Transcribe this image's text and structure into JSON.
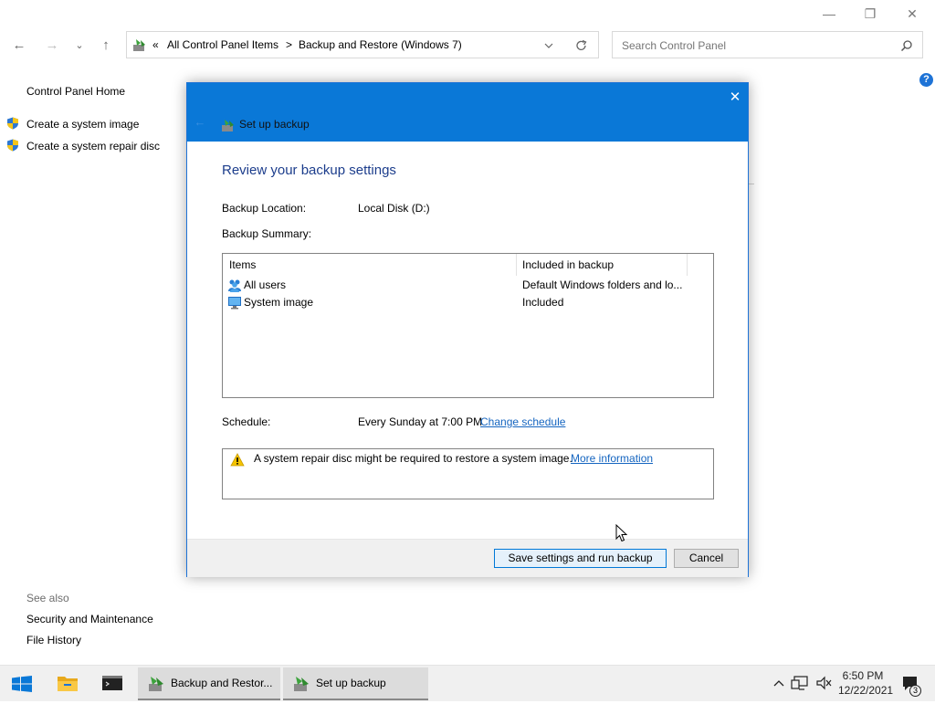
{
  "window": {
    "minimize_glyph": "—",
    "maximize_glyph": "❐",
    "close_glyph": "✕"
  },
  "nav": {
    "back_glyph": "←",
    "forward_glyph": "→",
    "recent_glyph": "⌄",
    "up_glyph": "↑"
  },
  "address": {
    "chevron": "«",
    "crumbs": [
      "All Control Panel Items",
      "Backup and Restore (Windows 7)"
    ],
    "separator": ">",
    "icon": "backup-icon"
  },
  "search": {
    "placeholder": "Search Control Panel"
  },
  "sidebar": {
    "home": "Control Panel Home",
    "links": [
      {
        "label": "Create a system image",
        "icon": "uac-shield-icon"
      },
      {
        "label": "Create a system repair disc",
        "icon": "uac-shield-icon"
      }
    ],
    "see_also_title": "See also",
    "see_also": [
      "Security and Maintenance",
      "File History"
    ]
  },
  "dialog": {
    "title": "Set up backup",
    "heading": "Review your backup settings",
    "location_label": "Backup Location:",
    "location_value": "Local Disk (D:)",
    "summary_label": "Backup Summary:",
    "table": {
      "headers": [
        "Items",
        "Included in backup"
      ],
      "rows": [
        {
          "item": "All users",
          "included": "Default Windows folders and lo...",
          "icon": "users-icon"
        },
        {
          "item": "System image",
          "included": "Included",
          "icon": "monitor-icon"
        }
      ]
    },
    "schedule_label": "Schedule:",
    "schedule_value": "Every Sunday at 7:00 PM",
    "change_schedule": "Change schedule",
    "warning_text": "A system repair disc might be required to restore a system image.",
    "more_info": "More information",
    "primary_button": "Save settings and run backup",
    "cancel_button": "Cancel"
  },
  "taskbar": {
    "windows": [
      {
        "label": "Backup and Restor...",
        "icon": "backup-icon"
      },
      {
        "label": "Set up backup",
        "icon": "backup-icon"
      }
    ],
    "time": "6:50 PM",
    "date": "12/22/2021",
    "notification_count": "3"
  },
  "colors": {
    "accent": "#0a78d7",
    "link": "#1565c0",
    "heading": "#1c3d8c"
  }
}
